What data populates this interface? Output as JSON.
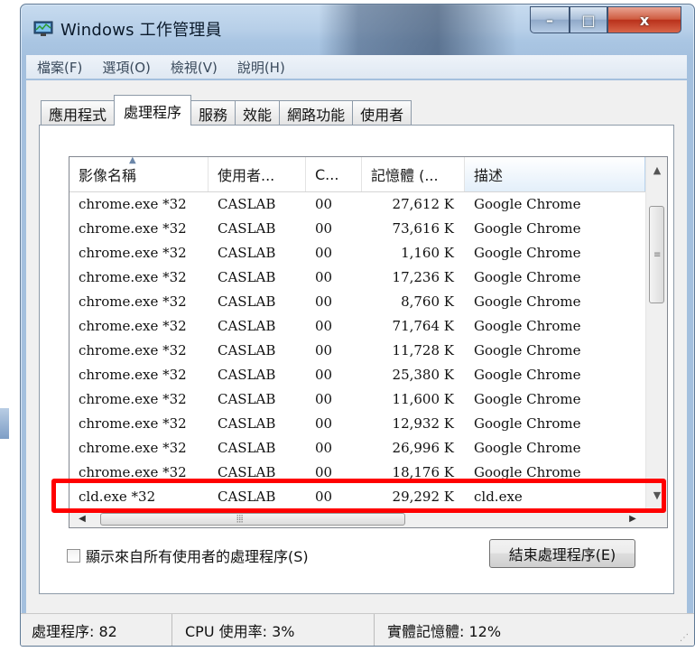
{
  "window": {
    "title": "Windows 工作管理員",
    "controls": {
      "minimize": "–",
      "maximize": "□",
      "close": "x"
    }
  },
  "menu": [
    "檔案(F)",
    "選項(O)",
    "檢視(V)",
    "說明(H)"
  ],
  "tabs": [
    {
      "label": "應用程式",
      "active": false
    },
    {
      "label": "處理程序",
      "active": true
    },
    {
      "label": "服務",
      "active": false
    },
    {
      "label": "效能",
      "active": false
    },
    {
      "label": "網路功能",
      "active": false
    },
    {
      "label": "使用者",
      "active": false
    }
  ],
  "table": {
    "columns": [
      "影像名稱",
      "使用者...",
      "C...",
      "記憶體 (...",
      "描述"
    ],
    "sorted_column": "影像名稱",
    "rows": [
      [
        "chrome.exe *32",
        "CASLAB",
        "00",
        "27,612 K",
        "Google Chrome"
      ],
      [
        "chrome.exe *32",
        "CASLAB",
        "00",
        "73,616 K",
        "Google Chrome"
      ],
      [
        "chrome.exe *32",
        "CASLAB",
        "00",
        "1,160 K",
        "Google Chrome"
      ],
      [
        "chrome.exe *32",
        "CASLAB",
        "00",
        "17,236 K",
        "Google Chrome"
      ],
      [
        "chrome.exe *32",
        "CASLAB",
        "00",
        "8,760 K",
        "Google Chrome"
      ],
      [
        "chrome.exe *32",
        "CASLAB",
        "00",
        "71,764 K",
        "Google Chrome"
      ],
      [
        "chrome.exe *32",
        "CASLAB",
        "00",
        "11,728 K",
        "Google Chrome"
      ],
      [
        "chrome.exe *32",
        "CASLAB",
        "00",
        "25,380 K",
        "Google Chrome"
      ],
      [
        "chrome.exe *32",
        "CASLAB",
        "00",
        "11,600 K",
        "Google Chrome"
      ],
      [
        "chrome.exe *32",
        "CASLAB",
        "00",
        "12,932 K",
        "Google Chrome"
      ],
      [
        "chrome.exe *32",
        "CASLAB",
        "00",
        "26,996 K",
        "Google Chrome"
      ],
      [
        "chrome.exe *32",
        "CASLAB",
        "00",
        "18,176 K",
        "Google Chrome"
      ],
      [
        "cld.exe *32",
        "CASLAB",
        "00",
        "29,292 K",
        "cld.exe"
      ]
    ],
    "highlighted_row_index": 12
  },
  "show_all_users_label": "顯示來自所有使用者的處理程序(S)",
  "end_process_button": "結束處理程序(E)",
  "status": {
    "processes": "處理程序: 82",
    "cpu": "CPU 使用率: 3%",
    "memory": "實體記憶體: 12%"
  },
  "colors": {
    "highlight": "#ff0000",
    "close_button": "#c73e22"
  }
}
